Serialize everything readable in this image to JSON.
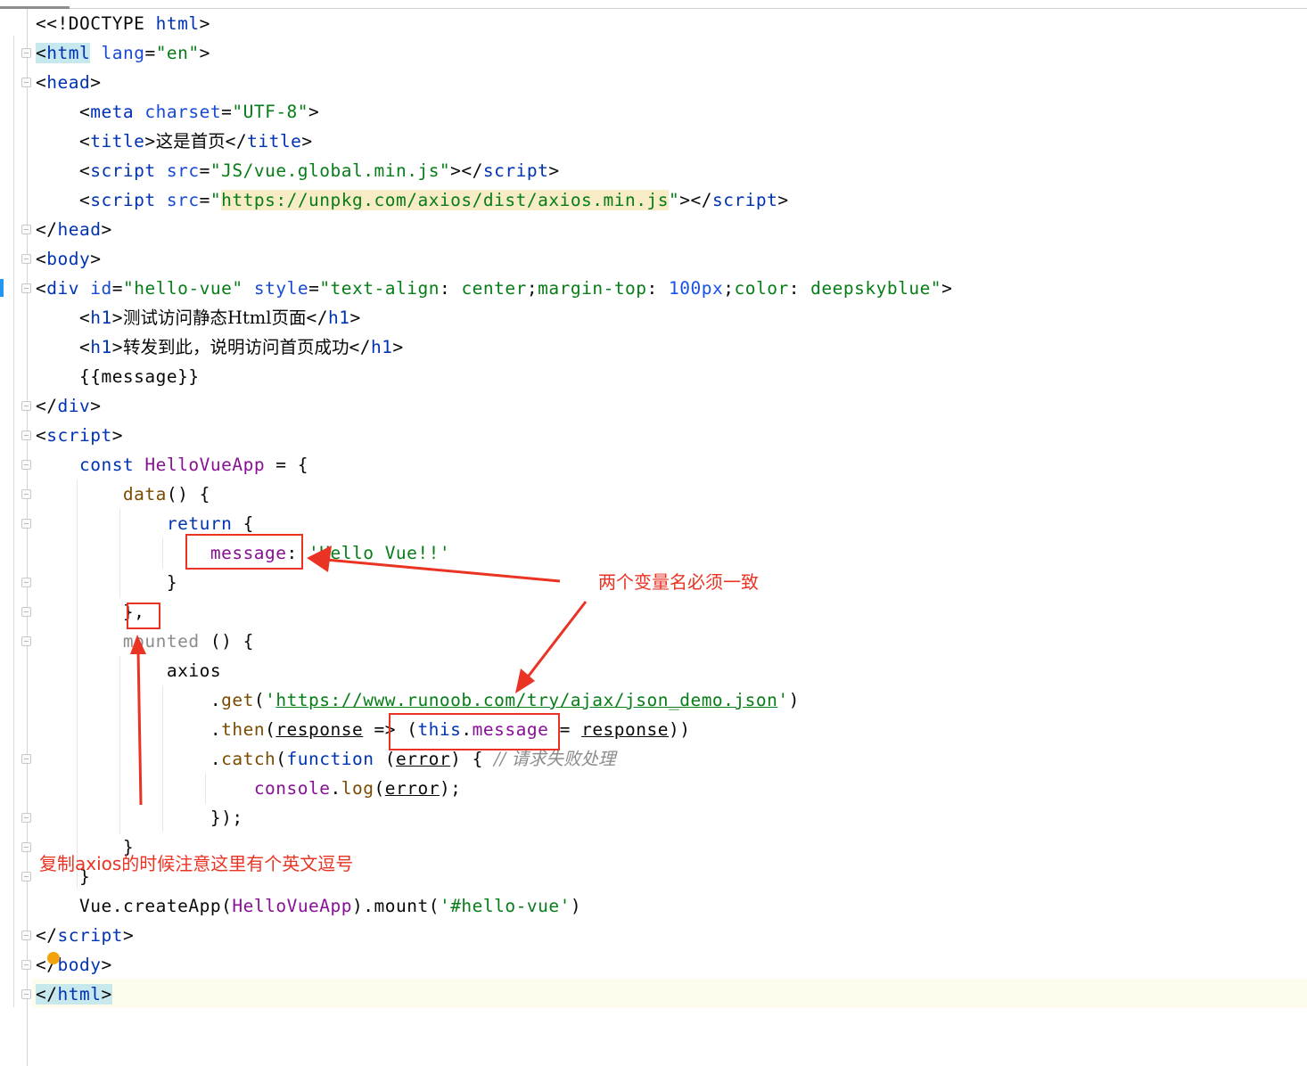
{
  "editor": {
    "accent_color": "#ea3323",
    "lines": {
      "l1_doctype": "<!DOCTYPE",
      "l1_html": "html",
      "l2_lang_val": "\"en\"",
      "l5_title_text": "这是首页",
      "l6_src": "\"JS/vue.global.min.js\"",
      "l7_src": "https://unpkg.com/axios/dist/axios.min.js",
      "l10_id": "\"hello-vue\"",
      "l10_style_a": "\"text-align",
      "l10_style_b": "center",
      "l10_style_c": "margin-top",
      "l10_style_d": "100px",
      "l10_style_e": "color",
      "l10_style_f": "deepskyblue\"",
      "l11_text": "测试访问静态Html页面",
      "l12_text": "转发到此，说明访问首页成功",
      "l13_text": "message",
      "l16_name": "HelloVueApp",
      "l17_name": "data",
      "l19_key": "message",
      "l19_val": "'Hello Vue!!'",
      "l22_name": "mounted",
      "l23_text": "axios",
      "l24_url": "https://www.runoob.com/try/ajax/json_demo.json",
      "l25_param": "response",
      "l25_field": "message",
      "l25_val": "response",
      "l26_param": "error",
      "l26_comment": "// 请求失败处理",
      "l27_obj": "console",
      "l27_mth": "log",
      "l27_arg": "error",
      "l31_vue": "Vue",
      "l31_create": "createApp",
      "l31_app": "HelloVueApp",
      "l31_mount": "mount",
      "l31_sel": "'#hello-vue'"
    }
  },
  "annotations": {
    "variable_names_note": "两个变量名必须一致",
    "comma_note": "复制axios的时候注意这里有个英文逗号"
  }
}
